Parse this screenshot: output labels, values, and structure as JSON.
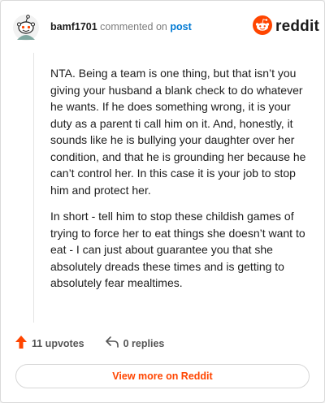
{
  "header": {
    "username": "bamf1701",
    "commented_on": "commented on",
    "post_link": "post",
    "brand": "reddit"
  },
  "comment": {
    "paragraphs": [
      "NTA. Being a team is one thing, but that isn’t you giving your husband a blank check to do whatever he wants. If he does something wrong, it is your duty as a parent ti call him on it. And, honestly, it sounds like he is bullying your daughter over her condition, and that he is grounding her because he can’t control her. In this case it is your job to stop him and protect her.",
      "In short - tell him to stop these childish games of trying to force her to eat things she doesn’t want to eat - I can just about guarantee you that she absolutely dreads these times and is getting to absolutely fear mealtimes."
    ]
  },
  "actions": {
    "upvotes": "11 upvotes",
    "replies": "0 replies"
  },
  "footer": {
    "view_more": "View more on Reddit"
  },
  "colors": {
    "accent": "#ff4500",
    "link": "#0079d3"
  },
  "icons": {
    "avatar": "snoo-avatar-icon",
    "brand": "reddit-logo-icon",
    "upvote": "upvote-arrow-icon",
    "reply": "reply-arrow-icon"
  }
}
